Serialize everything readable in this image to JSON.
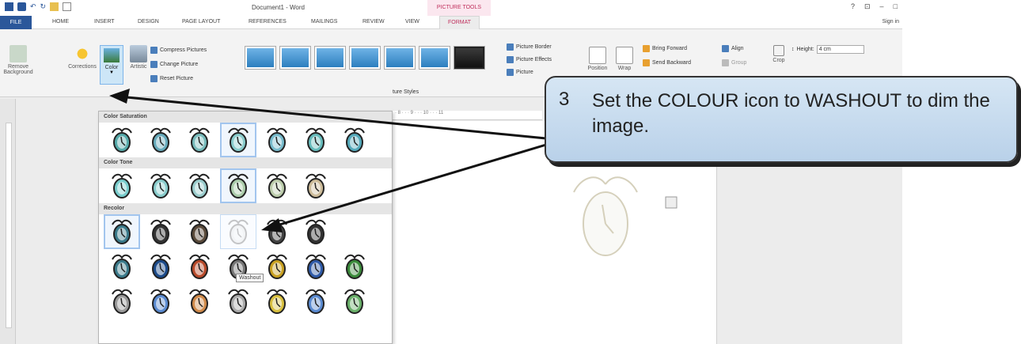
{
  "titlebar": {
    "doc_title": "Document1 - Word",
    "context_title": "PICTURE TOOLS",
    "help": "?",
    "restore": "⊡",
    "minimize": "–",
    "maximize": "□"
  },
  "tabs": [
    {
      "label": "FILE"
    },
    {
      "label": "HOME"
    },
    {
      "label": "INSERT"
    },
    {
      "label": "DESIGN"
    },
    {
      "label": "PAGE LAYOUT"
    },
    {
      "label": "REFERENCES"
    },
    {
      "label": "MAILINGS"
    },
    {
      "label": "REVIEW"
    },
    {
      "label": "VIEW"
    },
    {
      "label": "FORMAT"
    }
  ],
  "signin": "Sign in",
  "ribbon": {
    "remove_bg": "Remove Background",
    "corrections": "Corrections",
    "color": "Color",
    "artistic": "Artistic",
    "compress": "Compress Pictures",
    "change": "Change Picture",
    "reset": "Reset Picture",
    "styles_label": "ture Styles",
    "border": "Picture Border",
    "effects": "Picture Effects",
    "layout": "Picture",
    "position": "Position",
    "wrap": "Wrap",
    "bring_forward": "Bring Forward",
    "send_backward": "Send Backward",
    "align": "Align",
    "group": "Group",
    "crop": "Crop",
    "height_label": "Height:",
    "height_value": "4 cm"
  },
  "gallery": {
    "sections": [
      {
        "title": "Color Saturation",
        "tint": [
          "#5aa",
          "#6ab",
          "#7bb",
          "#8cc",
          "#7bc",
          "#6bb",
          "#5ab"
        ]
      },
      {
        "title": "Color Tone",
        "tint": [
          "#7cc",
          "#8cc",
          "#9cc",
          "#aca",
          "#bca",
          "#cb9"
        ]
      },
      {
        "title": "Recolor"
      }
    ],
    "recolor_rows": [
      [
        "#3a7a8a",
        "#333",
        "#5a4a3a",
        "#ddd",
        "#444",
        "#333"
      ],
      [
        "#3a7a8a",
        "#1b4a8a",
        "#b84a2a",
        "#777",
        "#c8a020",
        "#2e5aa8",
        "#3a8a3a"
      ],
      [
        "#999",
        "#5a8ad0",
        "#d08a4a",
        "#aaa",
        "#d8c040",
        "#5a8ad0",
        "#6ab06a"
      ]
    ],
    "tooltip": "Washout"
  },
  "ruler": "· 8 · · · 9 · · · 10 · · · 11",
  "callout": {
    "number": "3",
    "text": "Set the COLOUR icon to WASHOUT to dim the image."
  }
}
